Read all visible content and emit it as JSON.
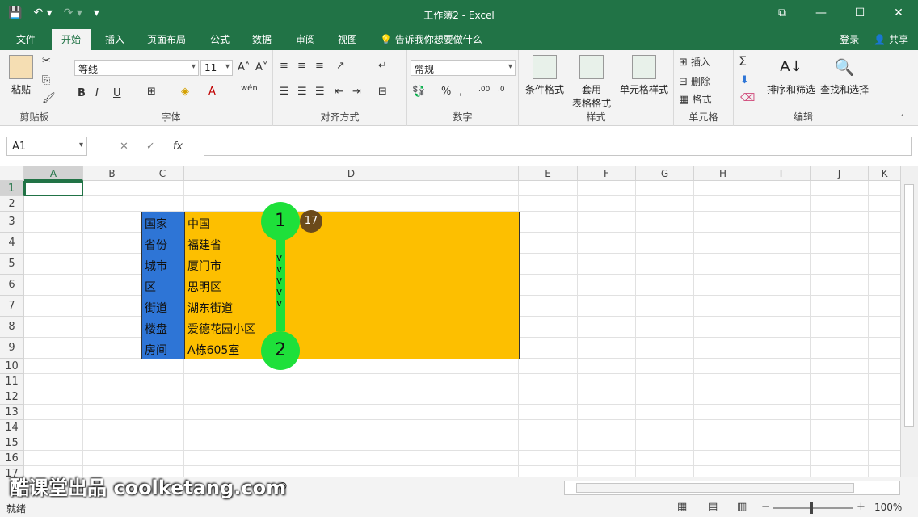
{
  "window": {
    "title": "工作簿2 - Excel",
    "min": "—",
    "max": "☐",
    "close": "✕",
    "ribbon_display": "⧉"
  },
  "tabs": {
    "file": "文件",
    "home": "开始",
    "insert": "插入",
    "layout": "页面布局",
    "formulas": "公式",
    "data": "数据",
    "review": "审阅",
    "view": "视图",
    "tellme": "告诉我你想要做什么",
    "login": "登录",
    "share": "共享"
  },
  "ribbon": {
    "clipboard": {
      "label": "剪贴板",
      "paste": "粘贴"
    },
    "font": {
      "label": "字体",
      "font_name": "等线",
      "font_size": "11",
      "bold": "B",
      "italic": "I",
      "underline": "U"
    },
    "align": {
      "label": "对齐方式"
    },
    "number": {
      "label": "数字",
      "format": "常规"
    },
    "styles": {
      "label": "样式",
      "cond": "条件格式",
      "table_a": "套用",
      "table_b": "表格格式",
      "cell": "单元格样式"
    },
    "cells": {
      "label": "单元格",
      "insert": "插入",
      "delete": "删除",
      "format": "格式"
    },
    "edit": {
      "label": "编辑",
      "sort": "排序和筛选",
      "find": "查找和选择"
    }
  },
  "formula": {
    "name": "A1",
    "fx": "fx"
  },
  "columns": [
    "A",
    "B",
    "C",
    "D",
    "E",
    "F",
    "G",
    "H",
    "I",
    "J",
    "K"
  ],
  "rows": [
    "1",
    "2",
    "3",
    "4",
    "5",
    "6",
    "7",
    "8",
    "9",
    "10",
    "11",
    "12",
    "13",
    "14",
    "15",
    "16",
    "17"
  ],
  "table": [
    {
      "label": "国家",
      "value": "中国"
    },
    {
      "label": "省份",
      "value": "福建省"
    },
    {
      "label": "城市",
      "value": "厦门市"
    },
    {
      "label": "区",
      "value": "思明区"
    },
    {
      "label": "街道",
      "value": "湖东街道"
    },
    {
      "label": "楼盘",
      "value": "爱德花园小区"
    },
    {
      "label": "房间",
      "value": "A栋605室"
    }
  ],
  "annotation": {
    "start": "1",
    "end": "2",
    "badge": "17",
    "chevron": "v"
  },
  "status": {
    "ready": "就绪",
    "zoom": "100%"
  },
  "watermark": "酷课堂出品 coolketang.com",
  "colors": {
    "excel_green": "#217346",
    "label_blue": "#2e75d6",
    "value_orange": "#fdbf00",
    "annot_green": "#1ee03a"
  }
}
